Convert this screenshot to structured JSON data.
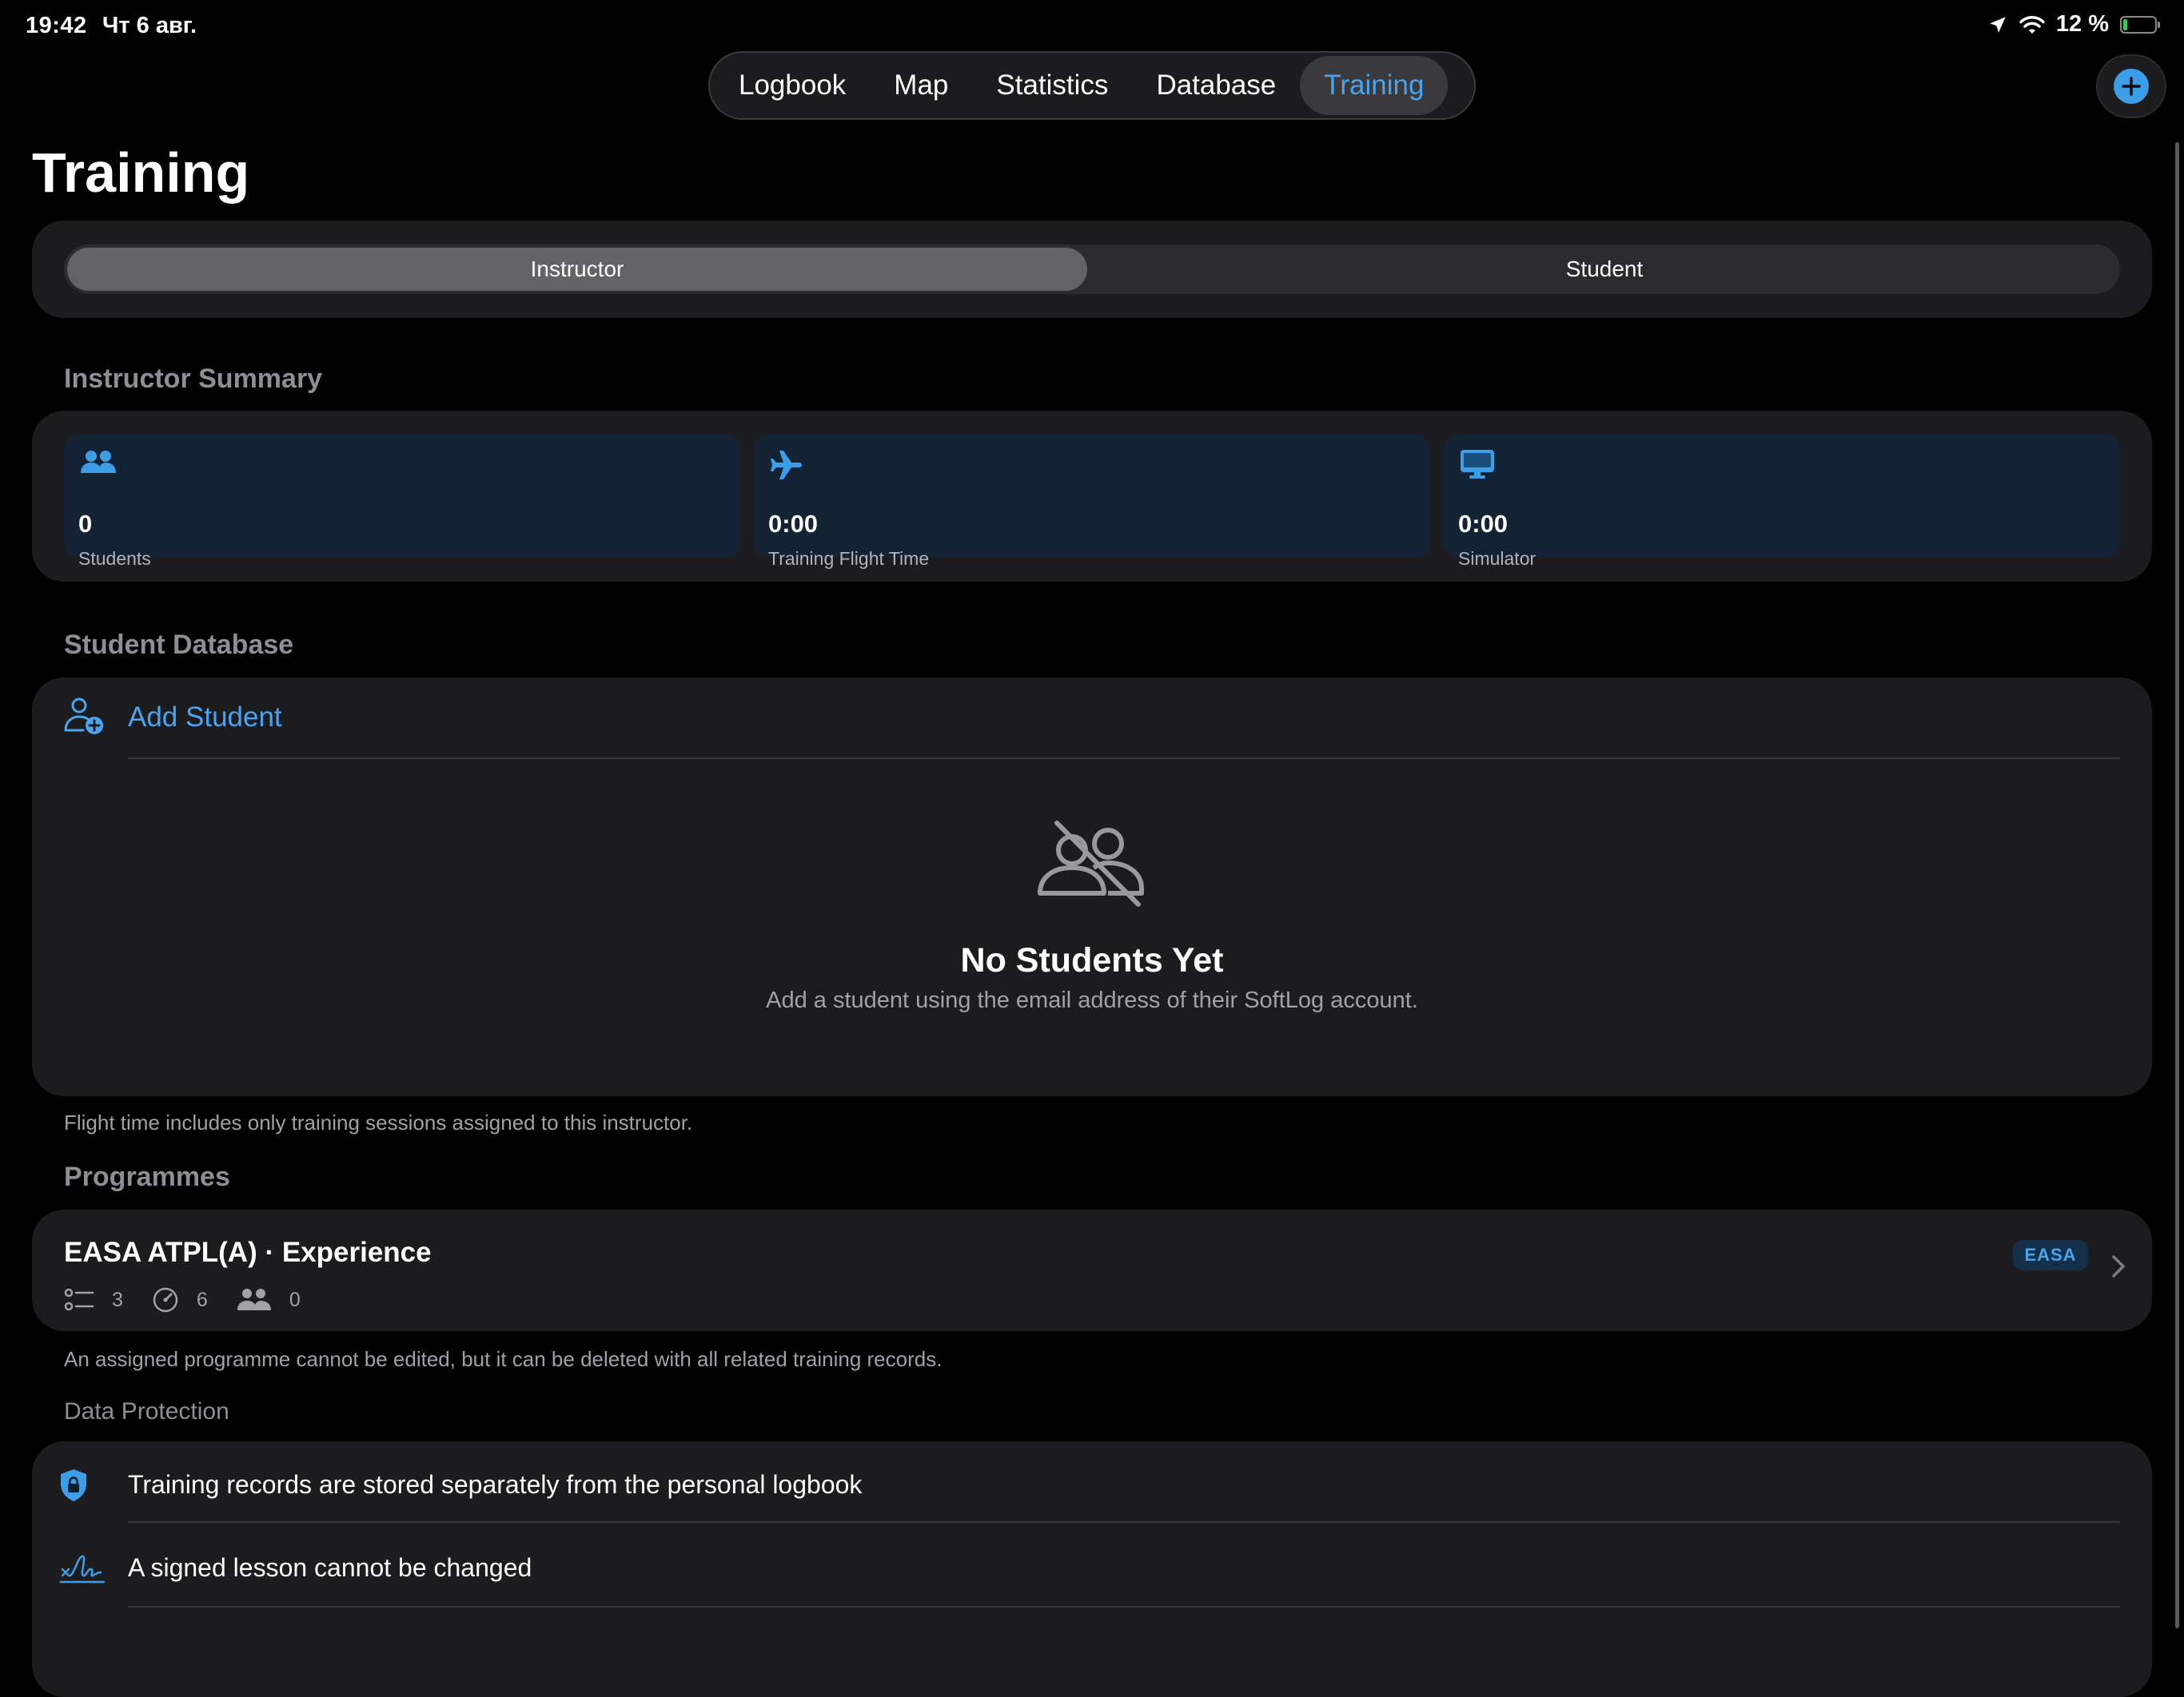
{
  "status_bar": {
    "time": "19:42",
    "date": "Чт 6 авг.",
    "battery": "12 %",
    "battery_level": 0.12
  },
  "nav": {
    "tabs": [
      {
        "label": "Logbook"
      },
      {
        "label": "Map"
      },
      {
        "label": "Statistics"
      },
      {
        "label": "Database"
      },
      {
        "label": "Training",
        "active": true
      }
    ]
  },
  "page": {
    "title": "Training"
  },
  "segment": {
    "options": [
      "Instructor",
      "Student"
    ],
    "selected": "Instructor"
  },
  "summary": {
    "heading": "Instructor Summary",
    "tiles": [
      {
        "icon": "people-icon",
        "value": "0",
        "label": "Students"
      },
      {
        "icon": "airplane-icon",
        "value": "0:00",
        "label": "Training Flight Time"
      },
      {
        "icon": "monitor-icon",
        "value": "0:00",
        "label": "Simulator"
      }
    ]
  },
  "student_db": {
    "heading": "Student Database",
    "add_label": "Add Student",
    "empty_title": "No Students Yet",
    "empty_subtitle": "Add a student using the email address of their SoftLog account.",
    "footnote": "Flight time includes only training sessions assigned to this instructor."
  },
  "programmes": {
    "heading": "Programmes",
    "items": [
      {
        "title": "EASA ATPL(A) · Experience",
        "lessons": "3",
        "flights": "6",
        "students": "0",
        "badge": "EASA"
      }
    ],
    "footnote": "An assigned programme cannot be edited, but it can be deleted with all related training records."
  },
  "data_protection": {
    "heading": "Data Protection",
    "items": [
      {
        "icon": "lock-shield-icon",
        "text": "Training records are stored separately from the personal logbook"
      },
      {
        "icon": "signature-icon",
        "text": "A signed lesson cannot be changed"
      }
    ]
  },
  "colors": {
    "accent": "#4aa3f0",
    "background": "#000000",
    "card": "#1c1c1e",
    "tile": "#132234"
  }
}
